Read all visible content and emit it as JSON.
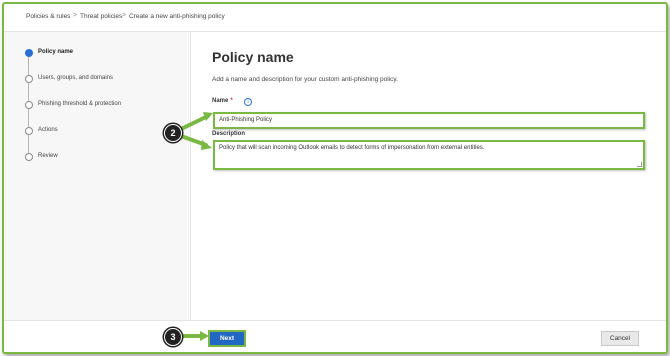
{
  "breadcrumb": {
    "items": [
      "Policies & rules",
      "Threat policies",
      "Create a new anti-phishing policy"
    ],
    "separator": ">"
  },
  "steps": [
    {
      "label": "Policy name",
      "active": true
    },
    {
      "label": "Users, groups, and domains",
      "active": false
    },
    {
      "label": "Phishing threshold & protection",
      "active": false
    },
    {
      "label": "Actions",
      "active": false
    },
    {
      "label": "Review",
      "active": false
    }
  ],
  "main": {
    "title": "Policy name",
    "description": "Add a name and description for your custom anti-phishing policy.",
    "name_label": "Name",
    "required_marker": "*",
    "info_icon": "info-icon",
    "name_value": "Anti-Phishing Policy",
    "description_label": "Description",
    "description_value": "Policy that will scan incoming Outlook emails to detect forms of impersonation from external entities."
  },
  "footer": {
    "next_label": "Next",
    "cancel_label": "Cancel"
  },
  "annotations": {
    "callout_2": "2",
    "callout_3": "3"
  },
  "colors": {
    "highlight": "#78b843",
    "primary": "#2367c4",
    "active_step": "#2b6fd6"
  }
}
